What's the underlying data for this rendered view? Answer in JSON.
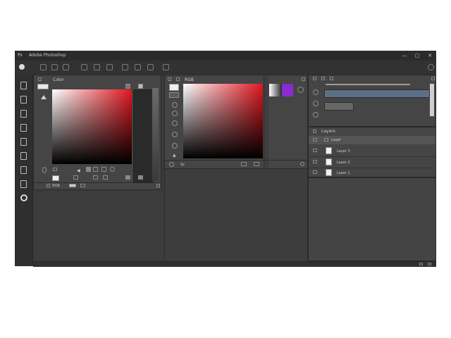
{
  "window": {
    "title": "Adobe Photoshop",
    "logo": "Ps",
    "controls": [
      "—",
      "▢",
      "✕"
    ]
  },
  "left_panel": {
    "tab_label": "Color",
    "bottom_label": "RGB"
  },
  "center_panel": {
    "tab_label": "RGB",
    "bottom_label": "Sz"
  },
  "right_panel": {
    "layers_tab": "Layers",
    "layer_rows": [
      {
        "name": "Layer 3"
      },
      {
        "name": "Layer 2"
      },
      {
        "name": "Layer 1"
      }
    ],
    "top_row_label": "Layer"
  },
  "colors": {
    "gradient_hue": "#e0161f",
    "swatch_purple": "#8a2bd1"
  }
}
